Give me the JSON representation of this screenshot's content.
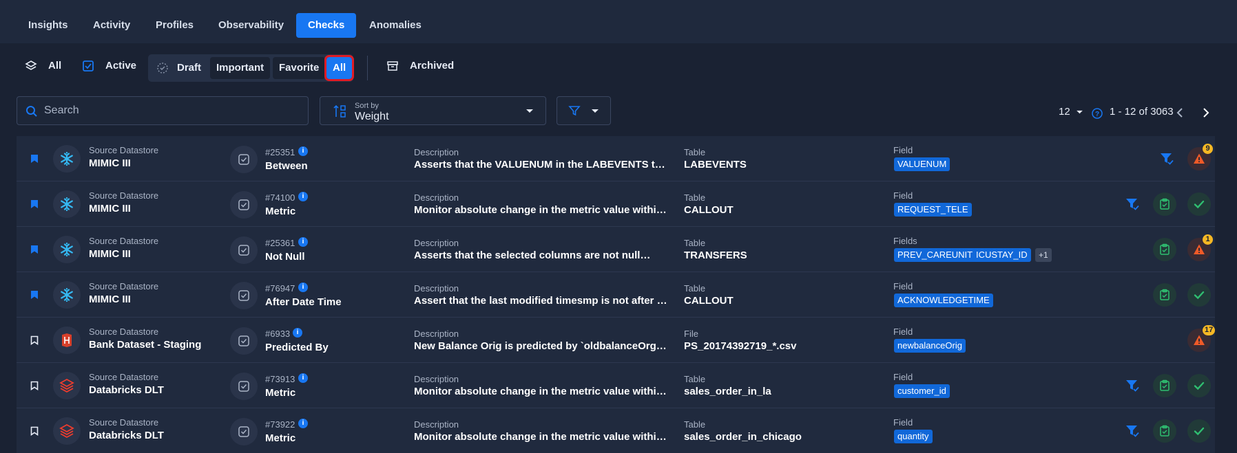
{
  "nav": {
    "tabs": [
      {
        "label": "Insights"
      },
      {
        "label": "Activity"
      },
      {
        "label": "Profiles"
      },
      {
        "label": "Observability"
      },
      {
        "label": "Checks"
      },
      {
        "label": "Anomalies"
      }
    ],
    "active": "Checks"
  },
  "filters": {
    "all_label": "All",
    "active_label": "Active",
    "draft_label": "Draft",
    "sub": [
      "Important",
      "Favorite",
      "All"
    ],
    "archived_label": "Archived"
  },
  "search": {
    "placeholder": "Search"
  },
  "sort": {
    "caption": "Sort by",
    "value": "Weight"
  },
  "pagination": {
    "page_size": "12",
    "range": "1 - 12 of 3063"
  },
  "colors": {
    "accent": "#1877f2",
    "highlight": "#e01b24",
    "warning": "#f6b824",
    "success": "#2fbf71",
    "danger": "#f05a28"
  },
  "rows": [
    {
      "bookmarked": true,
      "logo": "snowflake-icon",
      "src_label": "Source Datastore",
      "src": "MIMIC III",
      "id": "#25351",
      "rule": "Between",
      "desc_label": "Description",
      "desc": "Asserts that the VALUENUM in the LABEVENTS table for",
      "tbl_label": "Table",
      "tbl": "LABEVENTS",
      "field_label": "Field",
      "fields": [
        "VALUENUM"
      ],
      "more": "",
      "filter_icon": true,
      "tag_icon": false,
      "status": "anomaly",
      "badge": "9"
    },
    {
      "bookmarked": true,
      "logo": "snowflake-icon",
      "src_label": "Source Datastore",
      "src": "MIMIC III",
      "id": "#74100",
      "rule": "Metric",
      "desc_label": "Description",
      "desc": "Monitor absolute change in the metric value within the",
      "tbl_label": "Table",
      "tbl": "CALLOUT",
      "field_label": "Field",
      "fields": [
        "REQUEST_TELE"
      ],
      "more": "",
      "filter_icon": true,
      "tag_icon": true,
      "status": "passed",
      "badge": ""
    },
    {
      "bookmarked": true,
      "logo": "snowflake-icon",
      "src_label": "Source Datastore",
      "src": "MIMIC III",
      "id": "#25361",
      "rule": "Not Null",
      "desc_label": "Description",
      "desc": "Asserts that the selected columns are not null",
      "tbl_label": "Table",
      "tbl": "TRANSFERS",
      "field_label": "Fields",
      "fields": [
        "PREV_CAREUNIT",
        "ICUSTAY_ID"
      ],
      "more": "+1",
      "filter_icon": false,
      "tag_icon": true,
      "status": "anomaly",
      "badge": "1"
    },
    {
      "bookmarked": true,
      "logo": "snowflake-icon",
      "src_label": "Source Datastore",
      "src": "MIMIC III",
      "id": "#76947",
      "rule": "After Date Time",
      "desc_label": "Description",
      "desc": "Assert that the last modified timesmp is not after the d",
      "tbl_label": "Table",
      "tbl": "CALLOUT",
      "field_label": "Field",
      "fields": [
        "ACKNOWLEDGETIME"
      ],
      "more": "",
      "filter_icon": false,
      "tag_icon": true,
      "status": "passed",
      "badge": ""
    },
    {
      "bookmarked": false,
      "logo": "bank-icon",
      "src_label": "Source Datastore",
      "src": "Bank Dataset - Staging",
      "id": "#6933",
      "rule": "Predicted By",
      "desc_label": "Description",
      "desc": "New Balance Orig is predicted by `oldbalanceOrg` - `a",
      "tbl_label": "File",
      "tbl": "PS_20174392719_*.csv",
      "field_label": "Field",
      "fields": [
        "newbalanceOrig"
      ],
      "more": "",
      "filter_icon": false,
      "tag_icon": false,
      "status": "anomaly",
      "badge": "17"
    },
    {
      "bookmarked": false,
      "logo": "databricks-icon",
      "src_label": "Source Datastore",
      "src": "Databricks DLT",
      "id": "#73913",
      "rule": "Metric",
      "desc_label": "Description",
      "desc": "Monitor absolute change in the metric value within the",
      "tbl_label": "Table",
      "tbl": "sales_order_in_la",
      "field_label": "Field",
      "fields": [
        "customer_id"
      ],
      "more": "",
      "filter_icon": true,
      "tag_icon": true,
      "status": "passed",
      "badge": ""
    },
    {
      "bookmarked": false,
      "logo": "databricks-icon",
      "src_label": "Source Datastore",
      "src": "Databricks DLT",
      "id": "#73922",
      "rule": "Metric",
      "desc_label": "Description",
      "desc": "Monitor absolute change in the metric value within the",
      "tbl_label": "Table",
      "tbl": "sales_order_in_chicago",
      "field_label": "Field",
      "fields": [
        "quantity"
      ],
      "more": "",
      "filter_icon": true,
      "tag_icon": true,
      "status": "passed",
      "badge": ""
    }
  ]
}
